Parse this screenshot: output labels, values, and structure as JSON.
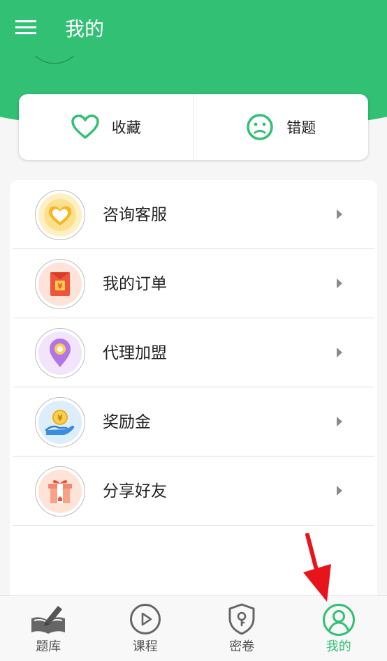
{
  "header": {
    "title": "我的"
  },
  "quick_actions": [
    {
      "label": "收藏",
      "icon": "heart-icon"
    },
    {
      "label": "错题",
      "icon": "sad-face-icon"
    }
  ],
  "menu": [
    {
      "label": "咨询客服",
      "icon": "heart-badge-icon",
      "color": "#f7c52b"
    },
    {
      "label": "我的订单",
      "icon": "red-envelope-icon",
      "color": "#f0543c"
    },
    {
      "label": "代理加盟",
      "icon": "location-pin-icon",
      "color": "#b275e8"
    },
    {
      "label": "奖励金",
      "icon": "coin-hand-icon",
      "color": "#3b8de0"
    },
    {
      "label": "分享好友",
      "icon": "gift-icon",
      "color": "#f08a6c"
    }
  ],
  "bottom_nav": [
    {
      "label": "题库",
      "icon": "book-pen-icon"
    },
    {
      "label": "课程",
      "icon": "play-circle-icon"
    },
    {
      "label": "密卷",
      "icon": "shield-lock-icon"
    },
    {
      "label": "我的",
      "icon": "user-icon",
      "active": true
    }
  ],
  "colors": {
    "brand": "#31c074",
    "annotation_arrow": "#e8141c"
  }
}
